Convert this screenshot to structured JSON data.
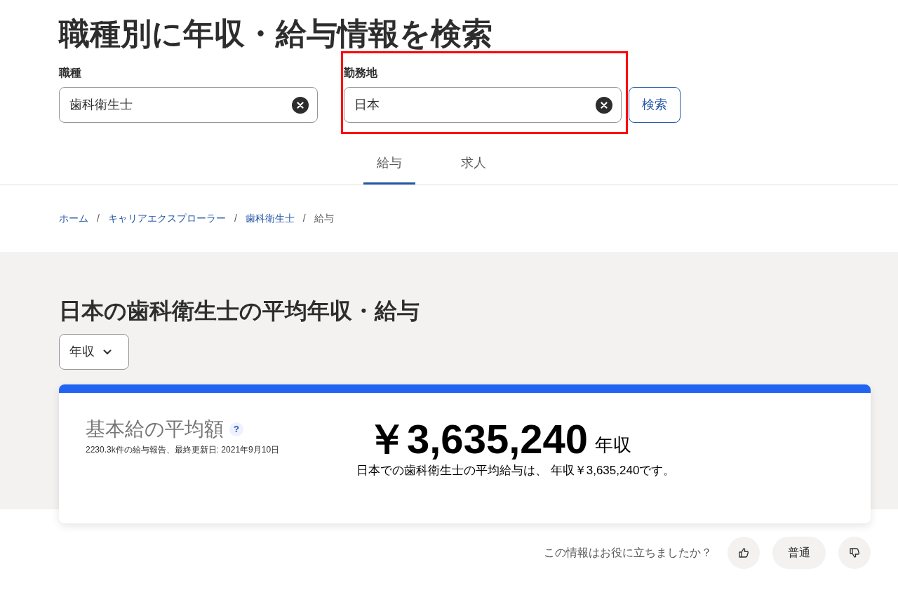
{
  "title": "職種別に年収・給与情報を検索",
  "search": {
    "fields": [
      {
        "label": "職種",
        "value": "歯科衛生士",
        "highlighted": false
      },
      {
        "label": "勤務地",
        "value": "日本",
        "highlighted": true
      }
    ],
    "button": "検索"
  },
  "tabs": [
    {
      "label": "給与",
      "selected": true
    },
    {
      "label": "求人",
      "selected": false
    }
  ],
  "breadcrumb": [
    {
      "label": "ホーム",
      "link": true
    },
    {
      "label": "キャリアエクスプローラー",
      "link": true
    },
    {
      "label": "歯科衛生士",
      "link": true
    },
    {
      "label": "給与",
      "link": false
    }
  ],
  "breadcrumb_separator": "/",
  "salary": {
    "heading": "日本の歯科衛生士の平均年収・給与",
    "period_select": "年収",
    "card": {
      "label": "基本給の平均額",
      "help": "?",
      "meta": "2230.3k件の給与報告、最終更新日: 2021年9月10日",
      "amount": "￥3,635,240",
      "unit": "年収",
      "summary": "日本での歯科衛生士の平均給与は、 年収￥3,635,240です。"
    }
  },
  "feedback": {
    "question": "この情報はお役に立ちましたか？",
    "neutral": "普通"
  }
}
